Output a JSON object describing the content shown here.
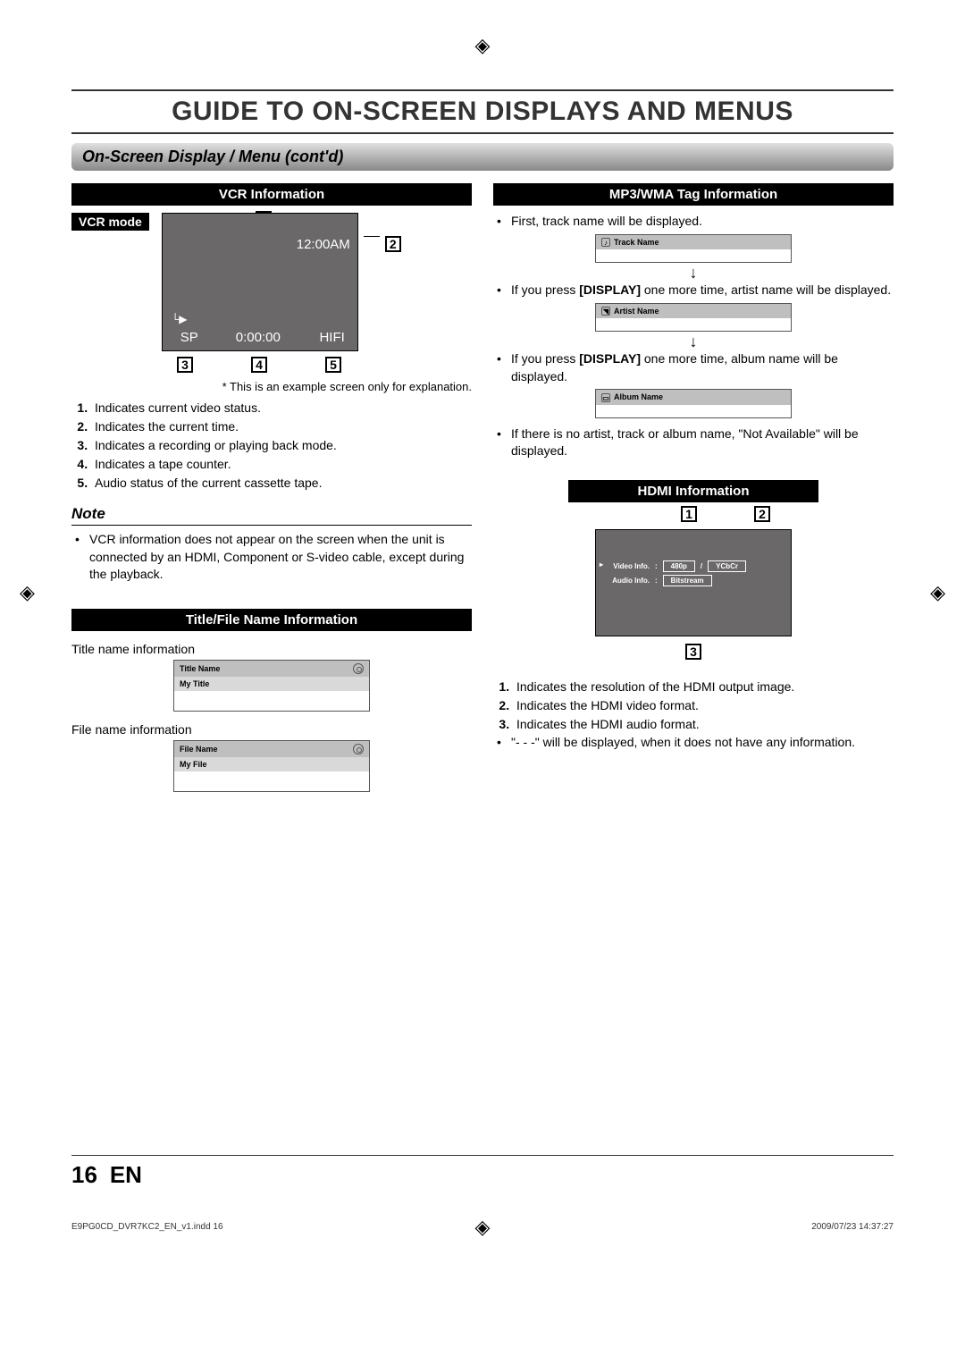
{
  "page": {
    "title": "GUIDE TO ON-SCREEN DISPLAYS AND MENUS",
    "section": "On-Screen Display / Menu (cont'd)",
    "page_number": "16",
    "lang": "EN",
    "slug_file": "E9PG0CD_DVR7KC2_EN_v1.indd   16",
    "slug_date": "2009/07/23   14:37:27"
  },
  "vcr": {
    "header": "VCR Information",
    "mode_label": "VCR mode",
    "time": "12:00AM",
    "sp": "SP",
    "counter": "0:00:00",
    "hifi": "HIFI",
    "footnote": "* This is an example screen only for explanation.",
    "items": [
      "Indicates current video status.",
      "Indicates the current time.",
      "Indicates a recording or playing back mode.",
      "Indicates a tape counter.",
      "Audio status of the current cassette tape."
    ],
    "note_heading": "Note",
    "note": "VCR information does not appear on the screen when the unit is connected by an HDMI, Component or S-video cable, except during the playback."
  },
  "title_file": {
    "header": "Title/File Name Information",
    "title_label": "Title name information",
    "title_box_hdr": "Title Name",
    "title_box_val": "My Title",
    "file_label": "File name information",
    "file_box_hdr": "File Name",
    "file_box_val": "My File"
  },
  "mp3": {
    "header": "MP3/WMA Tag Information",
    "line1": "First, track name will be displayed.",
    "box1": "Track Name",
    "line2a": "If you press ",
    "line2b": "[DISPLAY]",
    "line2c": " one more time, artist name will be displayed.",
    "box2": "Artist Name",
    "line3a": "If you press ",
    "line3b": "[DISPLAY]",
    "line3c": " one more time, album name will be displayed.",
    "box3": "Album Name",
    "line4": "If there is no artist, track or album name, \"Not Available\" will be displayed."
  },
  "hdmi": {
    "header": "HDMI Information",
    "video_label": "Video Info.",
    "video_val": "480p",
    "video_fmt": "YCbCr",
    "sep": "/",
    "audio_label": "Audio Info.",
    "audio_val": "Bitstream",
    "colon": ":",
    "items": [
      "Indicates the resolution of the HDMI output image.",
      "Indicates the HDMI video format.",
      "Indicates the HDMI audio format."
    ],
    "dash_note": "\"- - -\" will be displayed, when it does not have any information."
  },
  "callouts": {
    "n1": "1",
    "n2": "2",
    "n3": "3",
    "n4": "4",
    "n5": "5"
  },
  "glyphs": {
    "reg": "◈",
    "play_bracket": "└▶",
    "down": "↓"
  }
}
